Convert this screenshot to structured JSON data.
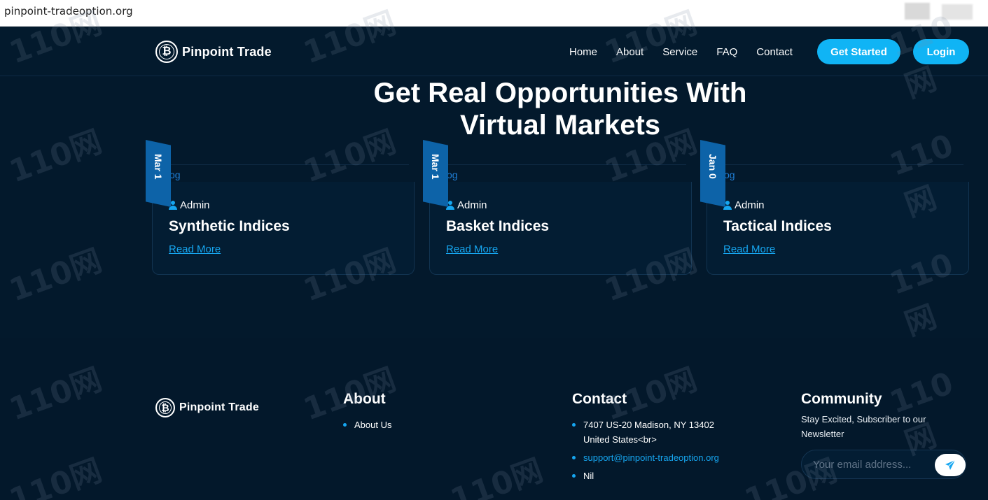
{
  "browser": {
    "url": "pinpoint-tradeoption.org"
  },
  "header": {
    "brand": "Pinpoint Trade",
    "logo_glyph": "₿",
    "nav": [
      "Home",
      "About",
      "Service",
      "FAQ",
      "Contact"
    ],
    "get_started": "Get Started",
    "login": "Login"
  },
  "hero": {
    "title_line1": "Get Real Opportunities With",
    "title_line2": "Virtual Markets"
  },
  "cards": [
    {
      "date": "Mar 1",
      "category": "og",
      "author": "Admin",
      "title": "Synthetic Indices",
      "link": "Read More"
    },
    {
      "date": "Mar 1",
      "category": "og",
      "author": "Admin",
      "title": "Basket Indices",
      "link": "Read More"
    },
    {
      "date": "Jan 0",
      "category": "og",
      "author": "Admin",
      "title": "Tactical Indices",
      "link": "Read More"
    }
  ],
  "footer": {
    "brand": "Pinpoint Trade",
    "about": {
      "title": "About",
      "items": [
        "About Us"
      ]
    },
    "contact": {
      "title": "Contact",
      "address": "7407 US-20 Madison, NY 13402 United States<br>",
      "email": "support@pinpoint-tradeoption.org",
      "phone": "Nil"
    },
    "community": {
      "title": "Community",
      "text": "Stay Excited, Subscriber to our Newsletter",
      "placeholder": "Your email address..."
    }
  },
  "watermark": "110网",
  "colors": {
    "accent": "#10b4f5",
    "background": "#03192c",
    "ribbon": "#0d63a8"
  }
}
